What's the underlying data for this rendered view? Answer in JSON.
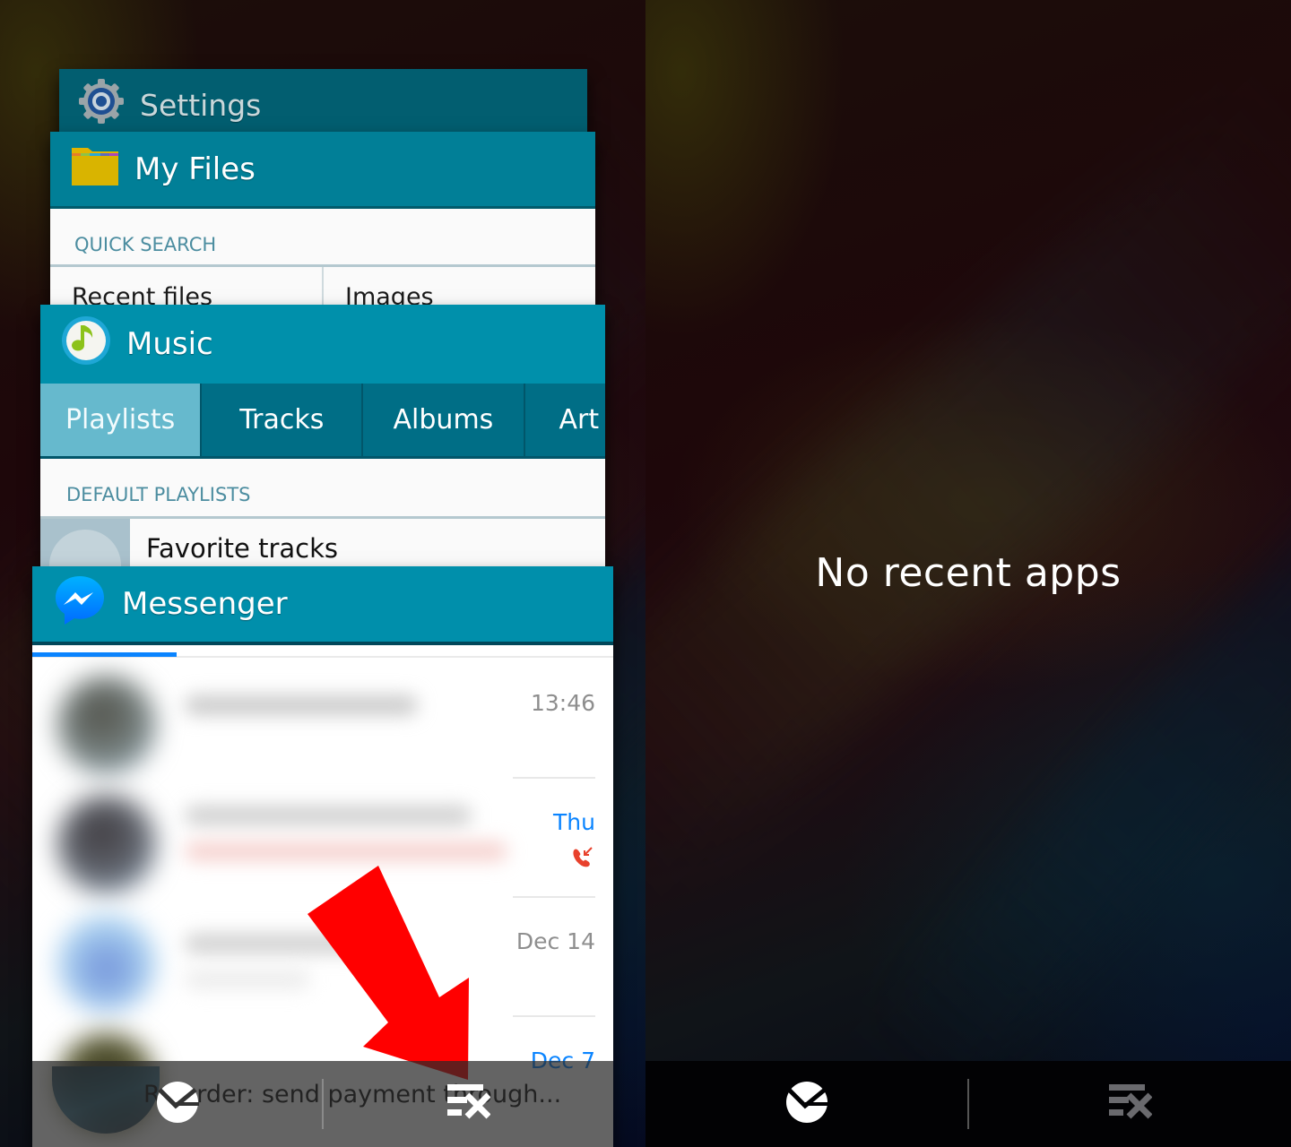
{
  "left_screen": {
    "recent_apps": [
      {
        "name": "Settings",
        "icon": "gear-icon"
      },
      {
        "name": "My Files",
        "icon": "folder-icon",
        "section_label": "QUICK SEARCH",
        "quick_search": [
          "Recent files",
          "Images"
        ]
      },
      {
        "name": "Music",
        "icon": "music-note-icon",
        "tabs": [
          "Playlists",
          "Tracks",
          "Albums",
          "Art"
        ],
        "active_tab": "Playlists",
        "section_label": "DEFAULT PLAYLISTS",
        "playlists": [
          "Favorite tracks"
        ]
      },
      {
        "name": "Messenger",
        "icon": "messenger-icon",
        "conversations": [
          {
            "time": "13:46",
            "unread": false,
            "missed_call": false
          },
          {
            "time": "Thu",
            "unread": true,
            "missed_call": true
          },
          {
            "time": "Dec 14",
            "unread": false,
            "missed_call": false
          },
          {
            "time": "Dec 7",
            "unread": true,
            "missed_call": false,
            "preview": "Re order: send payment through..."
          }
        ]
      }
    ],
    "bottom_bar": {
      "task_manager_icon": "task-manager-icon",
      "close_all_icon": "close-all-icon"
    },
    "annotation": {
      "type": "red-arrow",
      "points_to": "close-all-button",
      "color": "#ff0000"
    }
  },
  "right_screen": {
    "empty_message": "No recent apps",
    "bottom_bar": {
      "task_manager_icon": "task-manager-icon",
      "close_all_icon": "close-all-icon",
      "close_all_enabled": false
    }
  },
  "colors": {
    "header_teal": "#0090ab",
    "settings_header": "#025e70",
    "active_tab": "#66b9cd",
    "tab_bar": "#006e86",
    "messenger_blue": "#0a84ff",
    "missed_call_red": "#e8412c"
  }
}
